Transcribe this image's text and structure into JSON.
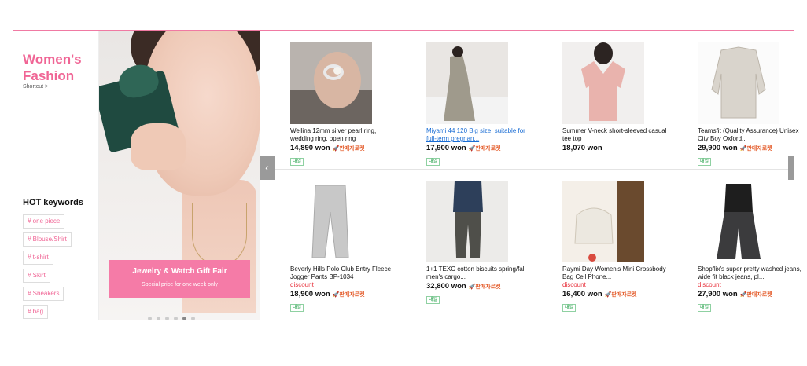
{
  "category": {
    "title": "Women's Fashion",
    "shortcut": "Shortcut >",
    "hot_keywords_title": "HOT keywords",
    "keywords": [
      "# one piece",
      "# Blouse/Shirt",
      "# t-shirt",
      "# Skirt",
      "# Sneakers",
      "# bag"
    ]
  },
  "banner": {
    "headline": "Jewelry & Watch Gift Fair",
    "subline": "Special price for one week only",
    "slide_count": 6,
    "active_slide": 5
  },
  "carousel": {
    "prev": "‹"
  },
  "products": [
    {
      "name": "Wellina 12mm silver pearl ring, wedding ring, open ring",
      "price": "14,890 won",
      "discount": "",
      "rocket": "🚀판매자로켓",
      "delivery_badge": "내일",
      "linked": false
    },
    {
      "name": "Miyami 44 120 Big size, suitable for full-term pregnan...",
      "price": "17,900 won",
      "discount": "",
      "rocket": "🚀판매자로켓",
      "delivery_badge": "내일",
      "linked": true
    },
    {
      "name": "Summer V-neck short-sleeved casual tee top",
      "price": "18,070 won",
      "discount": "",
      "rocket": "",
      "delivery_badge": "",
      "linked": false
    },
    {
      "name": "Teamsfit (Quality Assurance) Unisex City Boy Oxford...",
      "price": "29,900 won",
      "discount": "",
      "rocket": "🚀판매자로켓",
      "delivery_badge": "내일",
      "linked": false
    },
    {
      "name": "Beverly Hills Polo Club Entry Fleece Jogger Pants BP-1034",
      "price": "18,900 won",
      "discount": "discount",
      "rocket": "🚀판매자로켓",
      "delivery_badge": "내일",
      "linked": false
    },
    {
      "name": "1+1 TEXC cotton biscuits spring/fall men's cargo...",
      "price": "32,800 won",
      "discount": "",
      "rocket": "🚀판매자로켓",
      "delivery_badge": "내일",
      "linked": false
    },
    {
      "name": "Raymi Day Women's Mini Crossbody Bag Cell Phone...",
      "price": "16,400 won",
      "discount": "discount",
      "rocket": "🚀판매자로켓",
      "delivery_badge": "내일",
      "linked": false
    },
    {
      "name": "Shopflix's super pretty washed jeans, wide fit black jeans, pl...",
      "price": "27,900 won",
      "discount": "discount",
      "rocket": "🚀판매자로켓",
      "delivery_badge": "내일",
      "linked": false
    }
  ]
}
